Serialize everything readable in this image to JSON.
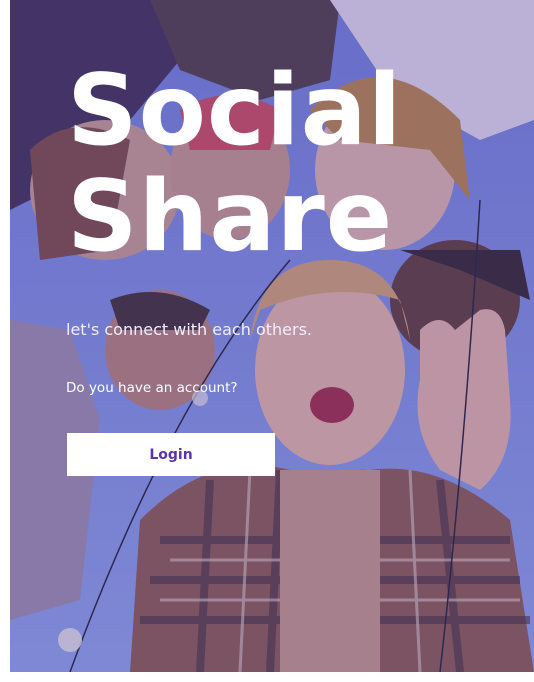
{
  "hero": {
    "title_line1": "Social",
    "title_line2": "Share",
    "tagline": "let's connect with each others.",
    "account_question": "Do you have an account?",
    "login_label": "Login",
    "overlay_color": "#5a44aa",
    "button_text_color": "#5b35a8"
  },
  "background": {
    "icon": "group-photo-background"
  }
}
